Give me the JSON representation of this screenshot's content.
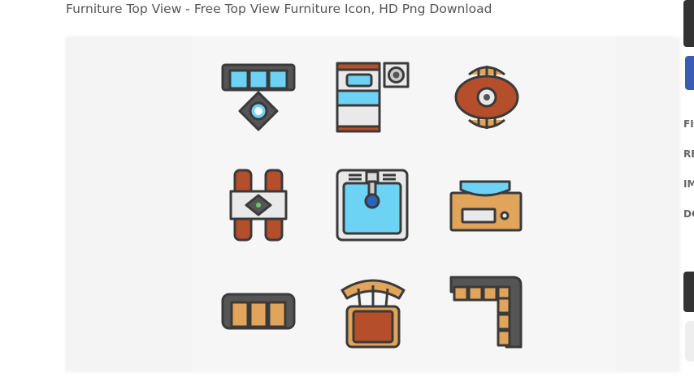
{
  "page": {
    "title": "Furniture Top View - Free Top View Furniture Icon, HD Png Download"
  },
  "preview": {
    "icons": [
      "sofa-with-table-icon",
      "bed-with-nightstand-icon",
      "round-table-with-chairs-icon",
      "dining-table-icon",
      "sink-icon",
      "computer-desk-icon",
      "three-seat-sofa-icon",
      "armchair-icon",
      "corner-sofa-icon"
    ]
  },
  "sidebar": {
    "labels": [
      "FII",
      "RE",
      "IM",
      "DC"
    ]
  },
  "colors": {
    "outline": "#3a3a3a",
    "blue": "#6dd3f5",
    "wood": "#b54e2b",
    "tan": "#e0a45b",
    "grey": "#d8d8d8"
  }
}
